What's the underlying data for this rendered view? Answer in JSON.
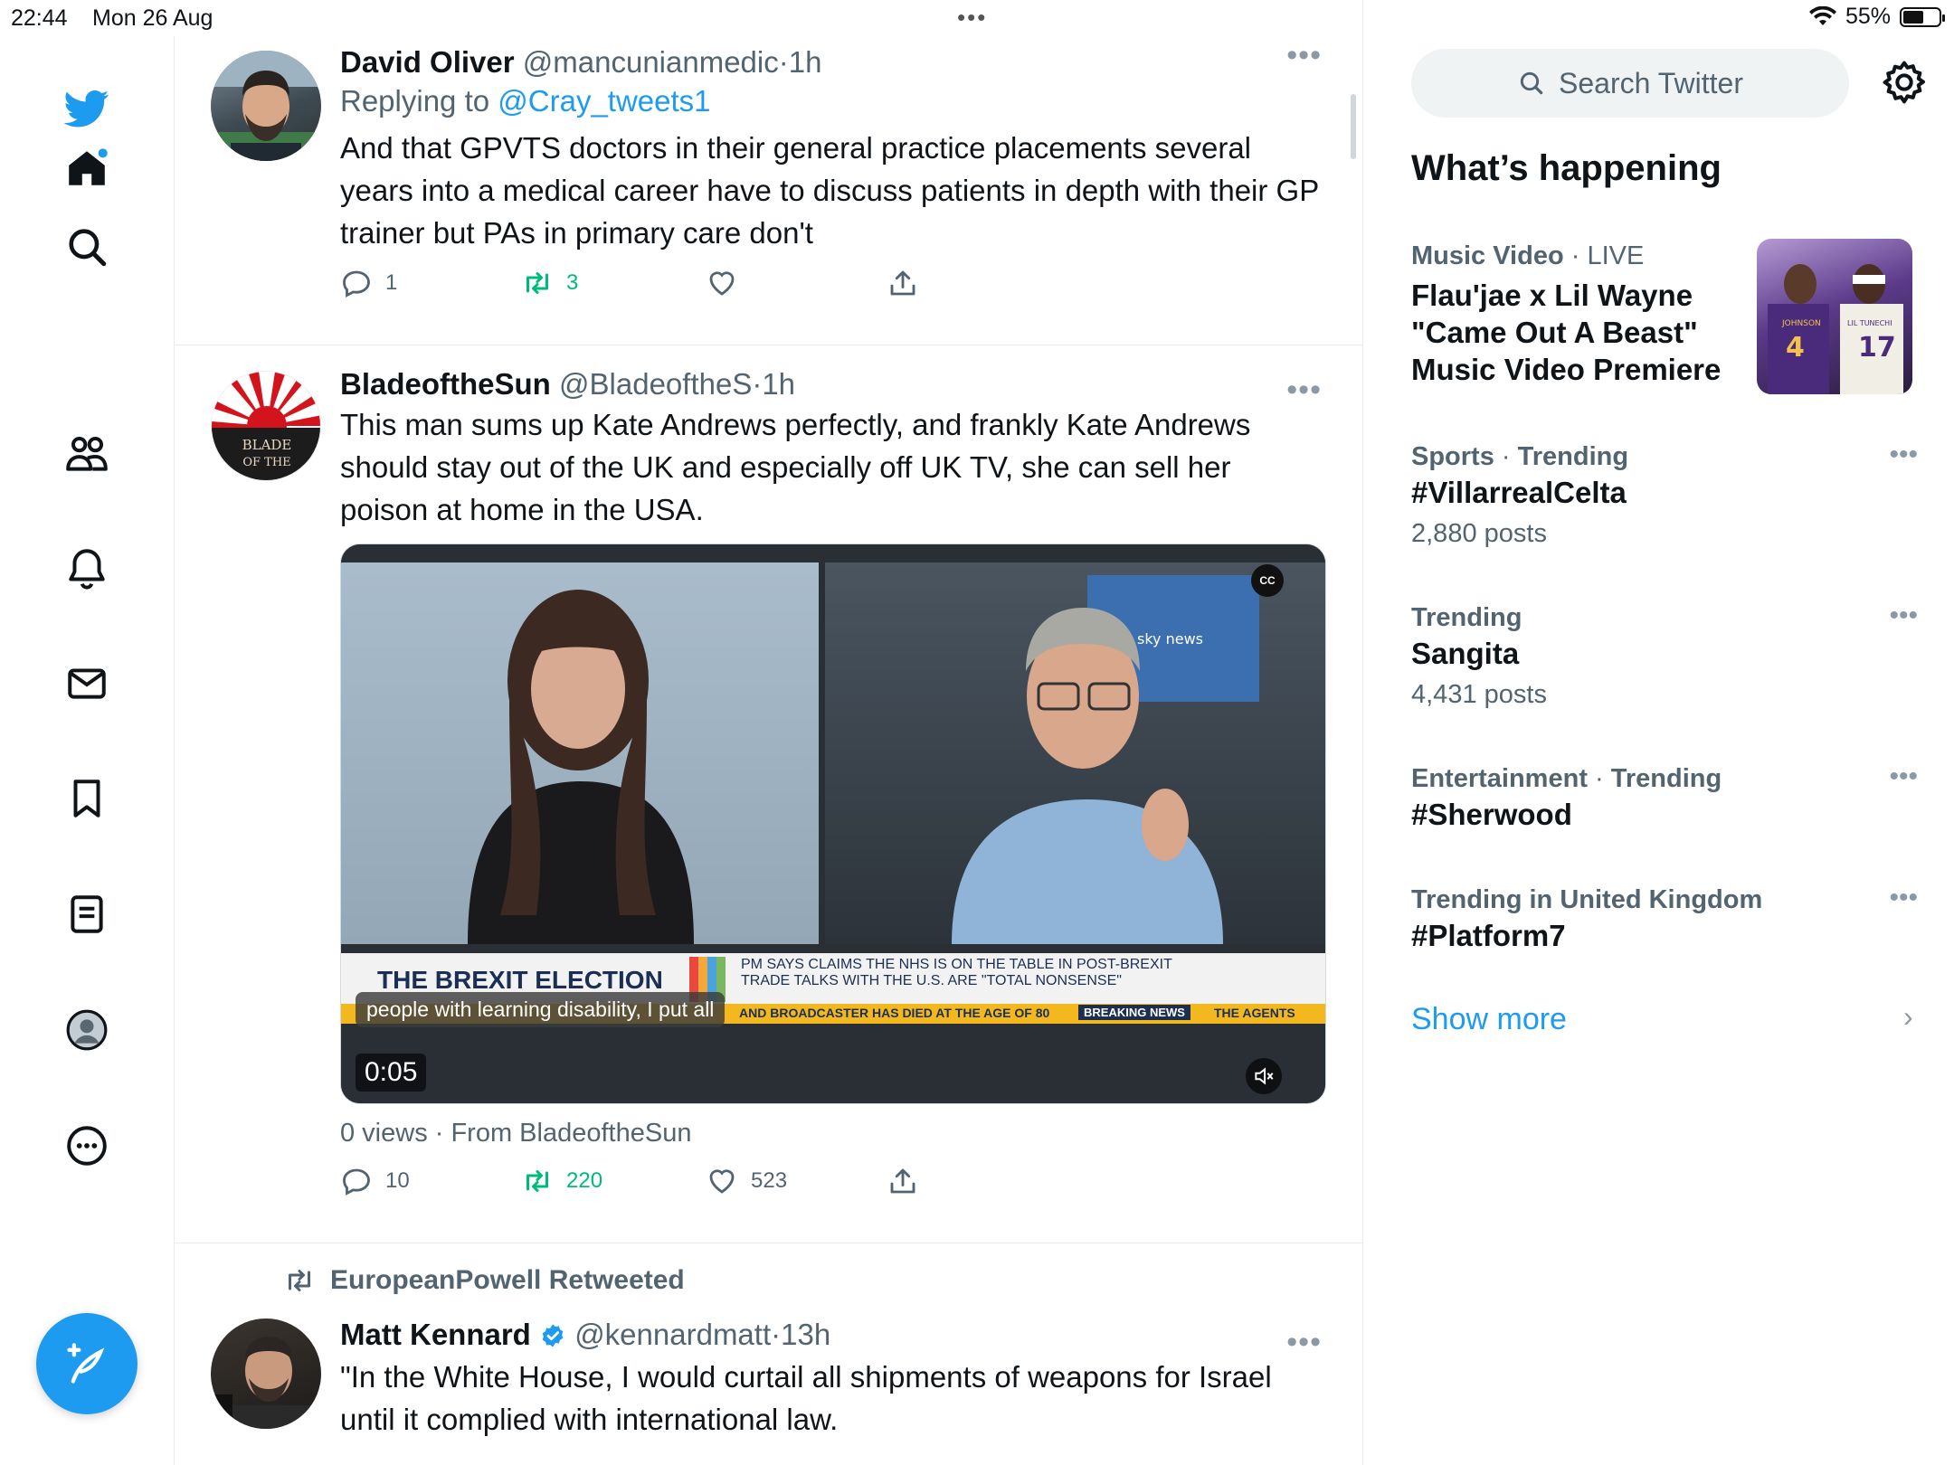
{
  "status_bar": {
    "time": "22:44",
    "date": "Mon 26 Aug",
    "battery": "55%"
  },
  "nav": {
    "items": [
      "twitter-logo-icon",
      "home-icon",
      "search-icon",
      "communities-icon",
      "notifications-icon",
      "messages-icon",
      "bookmarks-icon",
      "lists-icon",
      "profile-icon",
      "more-icon"
    ],
    "brand_color": "#1d9bf0"
  },
  "tweets": [
    {
      "name": "David Oliver",
      "handle": "@mancunianmedic",
      "sep": "·",
      "ago": "1h",
      "reply_prefix": "Replying to",
      "reply_handle": "@Cray_tweets1",
      "text": "And that GPVTS doctors in their general practice placements several years into a medical career  have to discuss patients in depth with their GP trainer but PAs in primary care don't",
      "replies": "1",
      "retweets": "3",
      "likes": ""
    },
    {
      "name": "BladeoftheSun",
      "handle": "@BladeoftheS",
      "sep": "·",
      "ago": "1h",
      "avatar_text": "BLADE OF THE",
      "text": "This man sums up Kate Andrews perfectly, and frankly Kate Andrews should stay out of the UK and especially off UK TV, she can sell her poison at home in the USA.",
      "video": {
        "ticker_title": "THE BREXIT ELECTION",
        "ticker_line1": "PM SAYS CLAIMS THE NHS IS ON THE TABLE IN POST-BREXIT",
        "ticker_line2": "TRADE TALKS WITH THE U.S. ARE \"TOTAL NONSENSE\"",
        "ticker_line3": "AND BROADCASTER HAS DIED AT THE AGE OF 80",
        "ticker_badge": "BREAKING NEWS",
        "ticker_tail": "THE AGENTS",
        "channel": "sky news",
        "caption": "people with learning disability, I put all",
        "duration": "0:05",
        "cc_label": "CC"
      },
      "views": "0 views · From BladeoftheSun",
      "replies": "10",
      "retweets": "220",
      "likes": "523"
    },
    {
      "retweeted_by": "EuropeanPowell Retweeted",
      "name": "Matt Kennard",
      "handle": "@kennardmatt",
      "sep": "·",
      "ago": "13h",
      "text": "\"In the White House, I would curtail all shipments of weapons for Israel until it complied with international law."
    }
  ],
  "sidebar": {
    "search_placeholder": "Search Twitter",
    "heading": "What’s happening",
    "trends": [
      {
        "category": "Music Video",
        "meta_suffix": "LIVE",
        "title": "Flau'jae x Lil Wayne \"Came Out A Beast\" Music Video Premiere",
        "jersey_left": "JOHNSON",
        "jersey_left_num": "4",
        "jersey_right": "LIL TUNECHI",
        "jersey_right_num": "17"
      },
      {
        "category": "Sports",
        "meta_suffix": "Trending",
        "title": "#VillarrealCelta",
        "count": "2,880 posts"
      },
      {
        "category": "Trending",
        "title": "Sangita",
        "count": "4,431 posts"
      },
      {
        "category": "Entertainment",
        "meta_suffix": "Trending",
        "title": "#Sherwood"
      },
      {
        "category": "Trending in United Kingdom",
        "title": "#Platform7"
      }
    ],
    "show_more": "Show more"
  }
}
